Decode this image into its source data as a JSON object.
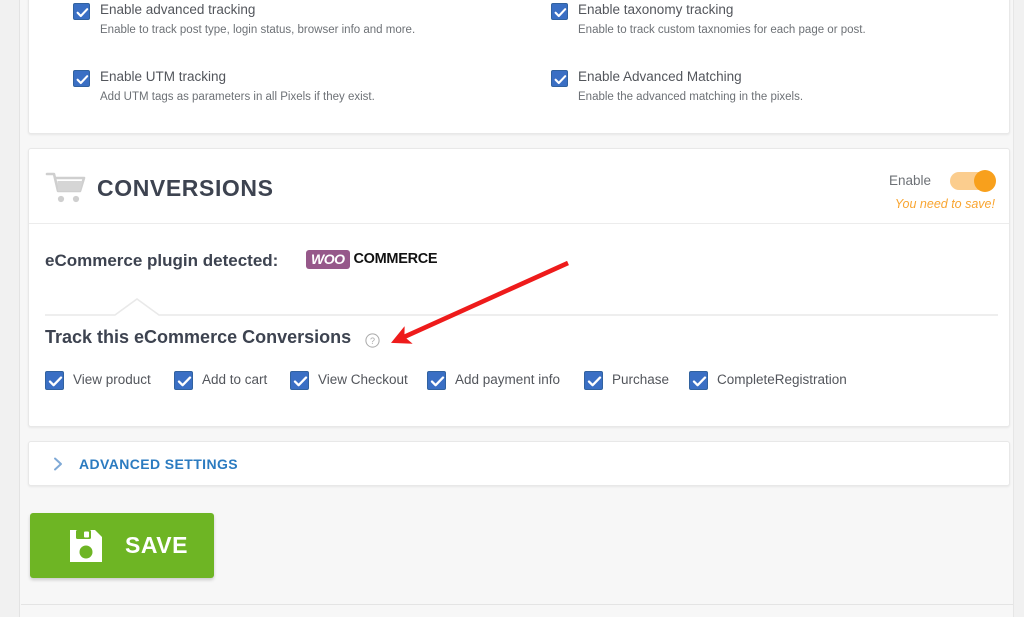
{
  "tracking_card": {
    "options": [
      {
        "label": "Enable advanced tracking",
        "description": "Enable to track post type, login status, browser info and more.",
        "checked": true
      },
      {
        "label": "Enable taxonomy tracking",
        "description": "Enable to track custom taxnomies for each page or post.",
        "checked": true
      },
      {
        "label": "Enable UTM tracking",
        "description": "Add UTM tags as parameters in all Pixels if they exist.",
        "checked": true
      },
      {
        "label": "Enable Advanced Matching",
        "description": "Enable the advanced matching in the pixels.",
        "checked": true
      }
    ]
  },
  "conversions": {
    "icon": "shopping-cart-icon",
    "title": "CONVERSIONS",
    "enable_label": "Enable",
    "toggle_state": "on",
    "save_notice": "You need to save!",
    "detected_label": "eCommerce plugin detected:",
    "detected_plugin": {
      "badge": "WOO",
      "word": "COMMERCE",
      "badge_color": "#96588a"
    },
    "track_heading": "Track this eCommerce Conversions",
    "help_icon": "question-mark-help-icon",
    "events": [
      {
        "label": "View product",
        "checked": true
      },
      {
        "label": "Add to cart",
        "checked": true
      },
      {
        "label": "View Checkout",
        "checked": true
      },
      {
        "label": "Add payment info",
        "checked": true
      },
      {
        "label": "Purchase",
        "checked": true
      },
      {
        "label": "CompleteRegistration",
        "checked": true
      }
    ]
  },
  "advanced_settings": {
    "label": "ADVANCED SETTINGS",
    "chevron": "chevron-right-icon",
    "expanded": false
  },
  "save_button": {
    "label": "SAVE",
    "icon": "floppy-disk-save-icon",
    "color": "#6eb524"
  },
  "annotation": {
    "type": "red-arrow",
    "color": "#ee1b1b",
    "from": "568,263",
    "to": "396,341"
  },
  "colors": {
    "checkbox": "#3a6fc4",
    "toggle_on": "#f8a01c",
    "notice": "#f9a531",
    "link_blue": "#2b7bc0",
    "save_green": "#6eb524"
  }
}
